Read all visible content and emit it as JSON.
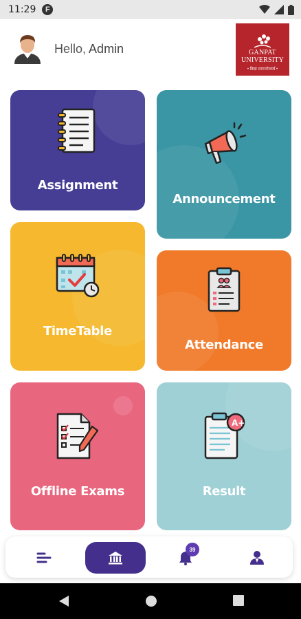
{
  "status_bar": {
    "time": "11:29",
    "app_badge": "F"
  },
  "header": {
    "greeting": "Hello,",
    "user_name": "Admin"
  },
  "logo": {
    "line1": "GANPAT",
    "line2": "UNIVERSITY",
    "tagline": "• विद्या समाजोत्कर्ष •"
  },
  "cards": [
    {
      "label": "Assignment",
      "color": "#463e95",
      "icon": "notepad-icon"
    },
    {
      "label": "Announcement",
      "color": "#3a95a4",
      "icon": "megaphone-icon"
    },
    {
      "label": "TimeTable",
      "color": "#f5b82e",
      "icon": "calendar-icon"
    },
    {
      "label": "Attendance",
      "color": "#f07a2a",
      "icon": "clipboard-icon"
    },
    {
      "label": "Offline Exams",
      "color": "#e9667f",
      "icon": "exam-paper-icon"
    },
    {
      "label": "Result",
      "color": "#9fd0d6",
      "icon": "result-icon"
    }
  ],
  "bottom_nav": {
    "items": [
      "menu-icon",
      "home-icon",
      "bell-icon",
      "profile-icon"
    ],
    "active": "home-icon",
    "notification_count": "39",
    "accent": "#44308c"
  }
}
